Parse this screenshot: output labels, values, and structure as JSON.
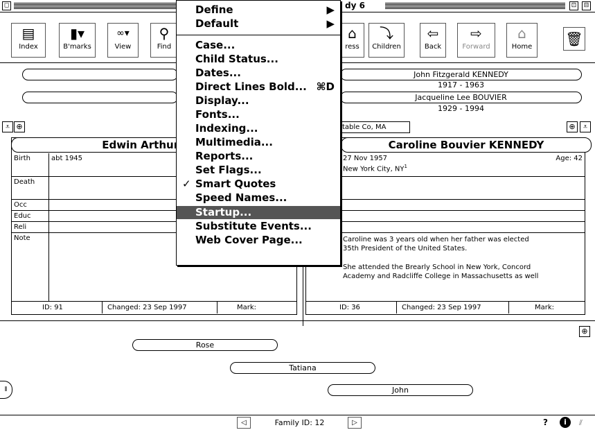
{
  "window": {
    "title": "dy 6",
    "close_icon": "close-box",
    "zoom_icon": "zoom-box"
  },
  "toolbar": {
    "index": "Index",
    "bookmarks": "B'marks",
    "view": "View",
    "find": "Find",
    "address": "ress",
    "children": "Children",
    "back": "Back",
    "forward": "Forward",
    "home": "Home"
  },
  "menu": {
    "items": [
      {
        "label": "Define",
        "submenu": true
      },
      {
        "label": "Default",
        "submenu": true
      },
      {
        "label": "Case..."
      },
      {
        "label": "Child Status..."
      },
      {
        "label": "Dates..."
      },
      {
        "label": "Direct Lines Bold...",
        "shortcut": "⌘D"
      },
      {
        "label": "Display..."
      },
      {
        "label": "Fonts..."
      },
      {
        "label": "Indexing..."
      },
      {
        "label": "Multimedia..."
      },
      {
        "label": "Reports..."
      },
      {
        "label": "Set Flags..."
      },
      {
        "label": "Smart Quotes",
        "checked": true
      },
      {
        "label": "Speed Names..."
      },
      {
        "label": "Startup...",
        "highlighted": true
      },
      {
        "label": "Substitute Events..."
      },
      {
        "label": "Web Cover Page..."
      }
    ]
  },
  "parents": {
    "father_name": "John Fitzgerald KENNEDY",
    "father_dates": "1917 - 1963",
    "mother_name": "Jacqueline Lee BOUVIER",
    "mother_dates": "1929 - 1994",
    "place": "table Co, MA"
  },
  "left_person": {
    "name": "Edwin Arthur SCH",
    "birth_label": "Birth",
    "birth_value": "abt 1945",
    "death_label": "Death",
    "occ_label": "Occ",
    "educ_label": "Educ",
    "reli_label": "Reli",
    "note_label": "Note",
    "id": "ID: 91",
    "changed": "Changed: 23 Sep 1997",
    "mark": "Mark:"
  },
  "right_person": {
    "name": "Caroline Bouvier KENNEDY",
    "birth_date": "27 Nov 1957",
    "birth_place": "New York City, NY",
    "footnote": "1",
    "age": "Age: 42",
    "note_1a": "Caroline was 3 years old when her father was elected",
    "note_1b": "35th President of the United States.",
    "note_2a": "She attended the Brearly School in New York, Concord",
    "note_2b": "Academy and Radcliffe College in Massachusetts as well",
    "id": "ID: 36",
    "changed": "Changed: 23 Sep 1997",
    "mark": "Mark:"
  },
  "children": {
    "c1": "Rose",
    "c2": "Tatiana",
    "c3": "John"
  },
  "status": {
    "family_id": "Family ID: 12",
    "help": "?"
  }
}
